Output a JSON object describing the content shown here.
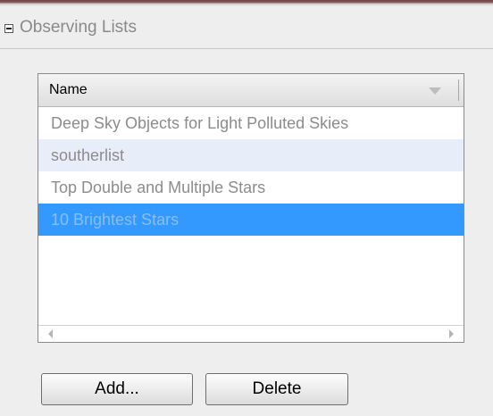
{
  "panel": {
    "title": "Observing Lists",
    "collapse_icon": "minus-box-icon"
  },
  "table": {
    "column_header": "Name",
    "sort_icon": "sort-descending-icon",
    "rows": [
      {
        "name": "Deep Sky Objects for Light Polluted Skies"
      },
      {
        "name": "southerlist"
      },
      {
        "name": "Top Double and Multiple Stars"
      },
      {
        "name": "10 Brightest Stars"
      },
      {
        "name": ""
      },
      {
        "name": ""
      }
    ],
    "selected_row": 3,
    "selection_color": "#3399ff",
    "alt_row_color": "#e8eef9"
  },
  "buttons": {
    "add_label": "Add...",
    "delete_label": "Delete"
  }
}
